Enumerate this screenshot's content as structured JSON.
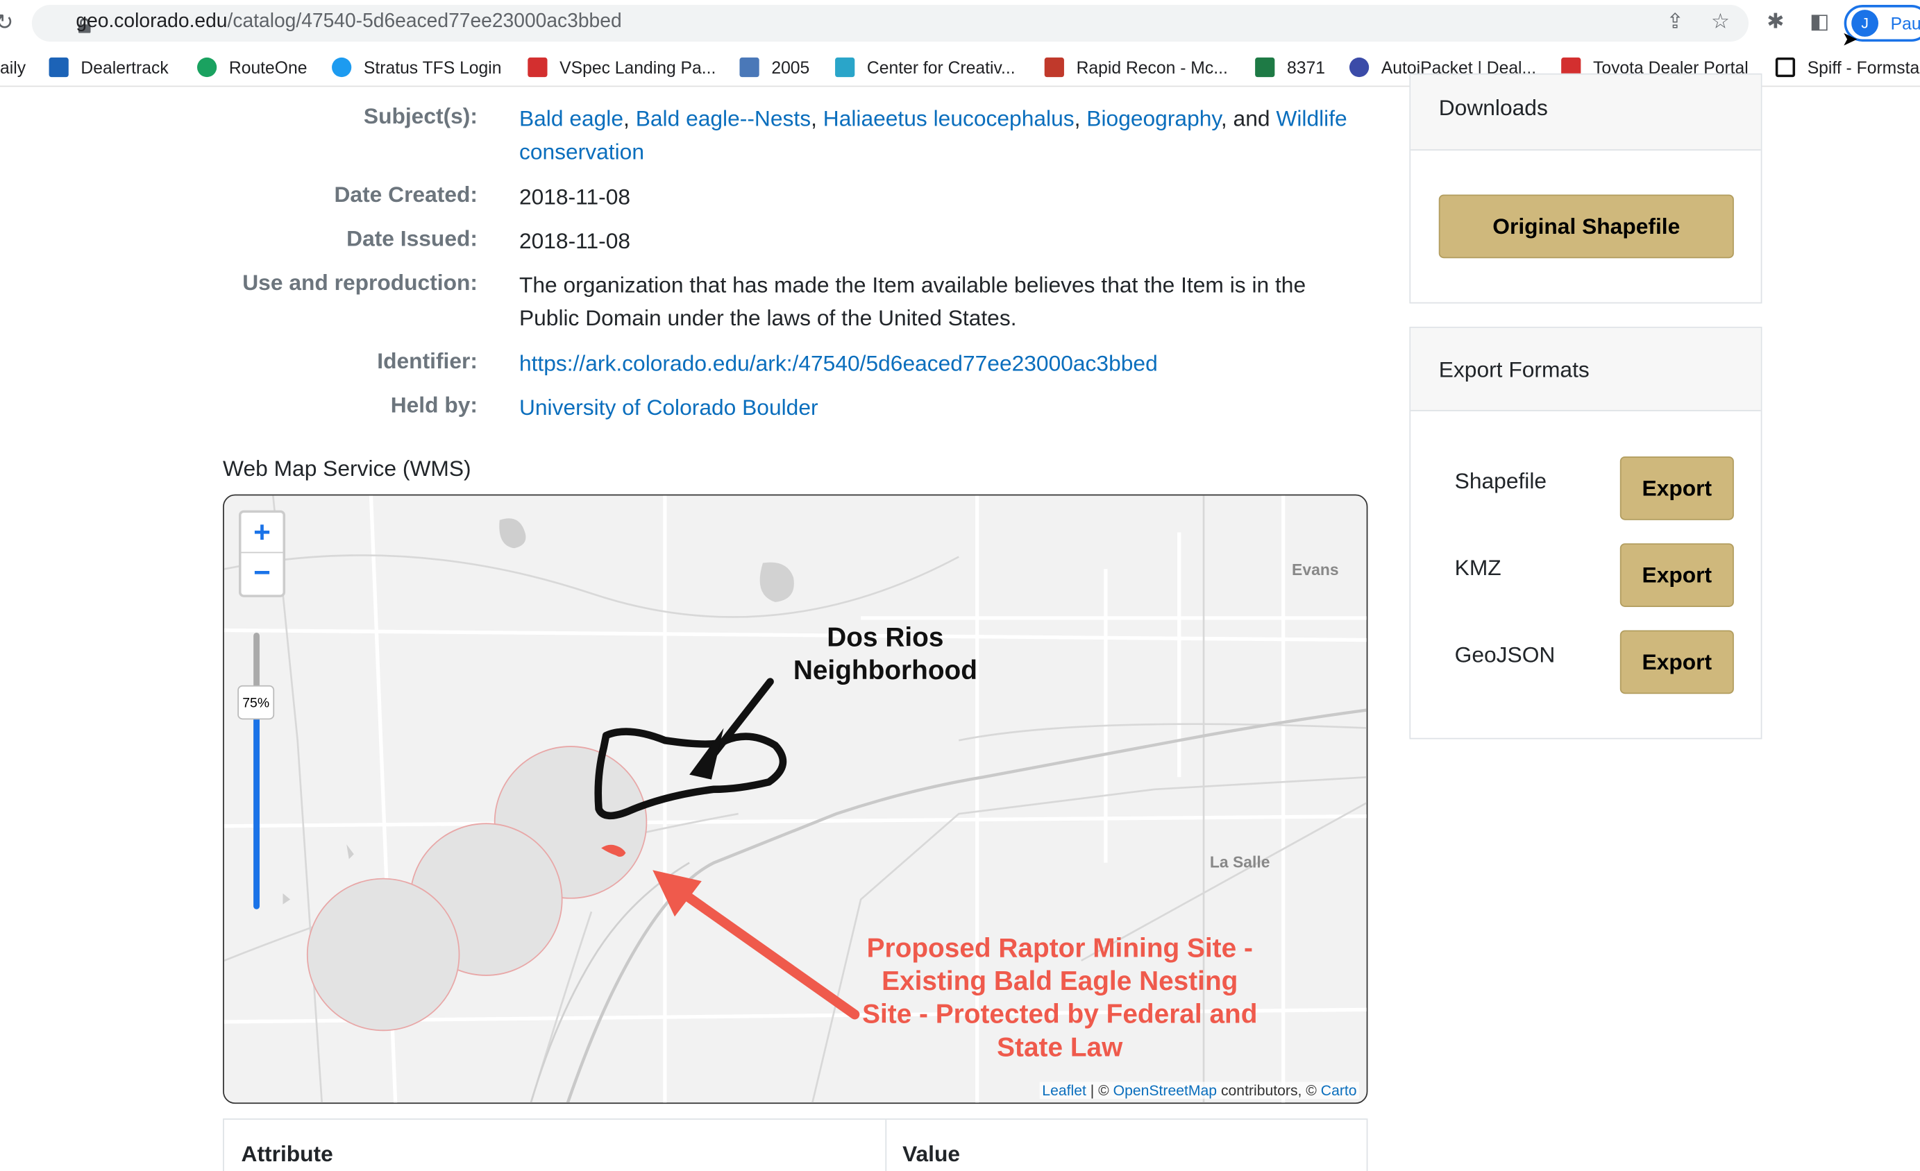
{
  "browser": {
    "url_host": "geo.colorado.edu",
    "url_path": "/catalog/47540-5d6eaced77ee23000ac3bbed",
    "profile_initial": "J",
    "profile_name": "Pau",
    "bookmarks": [
      {
        "label": "aily",
        "color": ""
      },
      {
        "label": "Dealertrack",
        "color": "#1c63b7"
      },
      {
        "label": "RouteOne",
        "color": "#1aa260"
      },
      {
        "label": "Stratus TFS Login",
        "color": "#1d9bf0"
      },
      {
        "label": "VSpec Landing Pa...",
        "color": "#d32f2f"
      },
      {
        "label": "2005",
        "color": "#4a78b8"
      },
      {
        "label": "Center for Creativ...",
        "color": "#2aa5c9"
      },
      {
        "label": "Rapid Recon - Mc...",
        "color": "#c0392b"
      },
      {
        "label": "8371",
        "color": "#1e7a45"
      },
      {
        "label": "AutoiPacket | Deal...",
        "color": "#3b4ba8"
      },
      {
        "label": "Toyota Dealer Portal",
        "color": "#d32f2f"
      },
      {
        "label": "Spiff - Formsta",
        "color": "#111111"
      }
    ]
  },
  "metadata": {
    "subjects_label": "Subject(s):",
    "subjects": [
      "Bald eagle",
      "Bald eagle--Nests",
      "Haliaeetus leucocephalus",
      "Biogeography",
      "Wildlife conservation"
    ],
    "subjects_sep": ", ",
    "subjects_and": ", and ",
    "date_created_label": "Date Created:",
    "date_created": "2018-11-08",
    "date_issued_label": "Date Issued:",
    "date_issued": "2018-11-08",
    "use_label": "Use and reproduction:",
    "use_text": "The organization that has made the Item available believes that the Item is in the Public Domain under the laws of the United States.",
    "identifier_label": "Identifier:",
    "identifier": "https://ark.colorado.edu/ark:/47540/5d6eaced77ee23000ac3bbed",
    "held_by_label": "Held by:",
    "held_by": "University of Colorado Boulder"
  },
  "map": {
    "section_title": "Web Map Service (WMS)",
    "zoom_in": "+",
    "zoom_out": "−",
    "opacity_label": "75%",
    "opacity_value": 0.75,
    "place_evans": "Evans",
    "place_lasalle": "La Salle",
    "annotation_neighborhood": "Dos Rios Neighborhood",
    "annotation_mining": "Proposed Raptor Mining Site - Existing Bald Eagle Nesting Site - Protected by Federal and State Law",
    "attribution_leaflet": "Leaflet",
    "attribution_sep1": " | © ",
    "attribution_osm": "OpenStreetMap",
    "attribution_sep2": " contributors, © ",
    "attribution_carto": "Carto",
    "colors": {
      "annotation_red": "#ef5a4c",
      "buffer_fill": "#e3e3e3",
      "buffer_stroke": "#e8a7a7"
    }
  },
  "table": {
    "col_attribute": "Attribute",
    "col_value": "Value"
  },
  "sidebar": {
    "downloads_title": "Downloads",
    "original_button": "Original Shapefile",
    "export_title": "Export Formats",
    "formats": [
      {
        "label": "Shapefile",
        "button": "Export"
      },
      {
        "label": "KMZ",
        "button": "Export"
      },
      {
        "label": "GeoJSON",
        "button": "Export"
      }
    ],
    "accent": "#cfb87c"
  }
}
